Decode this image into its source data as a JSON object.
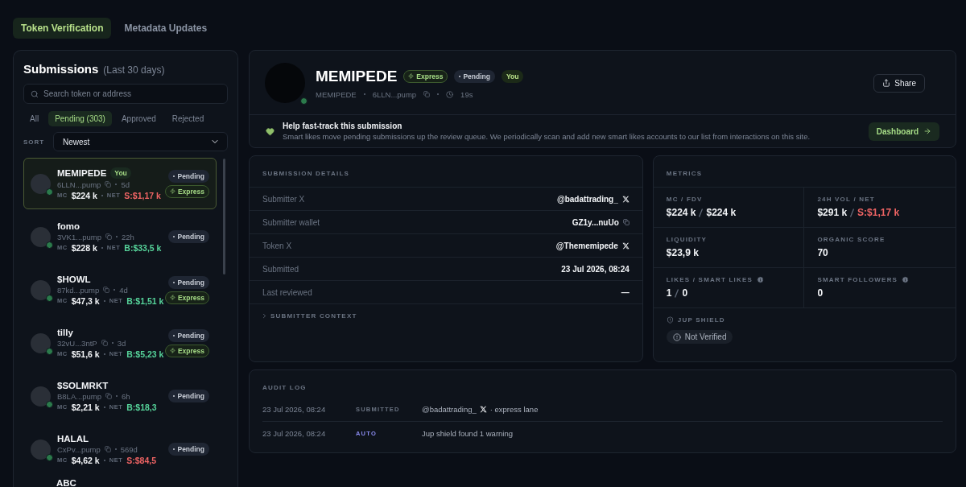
{
  "top_tabs": [
    {
      "label": "Token Verification",
      "selected": true
    },
    {
      "label": "Metadata Updates",
      "selected": false
    }
  ],
  "sidebar": {
    "title": "Submissions",
    "subtitle": "(Last 30 days)",
    "search": {
      "placeholder": "Search token or address"
    },
    "filters": [
      {
        "label": "All",
        "selected": false
      },
      {
        "label": "Pending (303)",
        "selected": true
      },
      {
        "label": "Approved",
        "selected": false
      },
      {
        "label": "Rejected",
        "selected": false
      }
    ],
    "sort_label": "SORT",
    "sort_value": "Newest",
    "items": [
      {
        "name": "MEMIPEDE",
        "badge": "You",
        "address": "6LLN...pump",
        "age": "5d",
        "mc_label": "MC",
        "mc": "$224 k",
        "net_label": "NET",
        "net": {
          "text": "S:$1,17 k",
          "kind": "sell"
        },
        "status": "Pending",
        "express": "Express",
        "selected": true
      },
      {
        "name": "fomo",
        "address": "3VK1...pump",
        "age": "22h",
        "mc_label": "MC",
        "mc": "$228 k",
        "net_label": "NET",
        "net": {
          "text": "B:$33,5 k",
          "kind": "buy"
        },
        "status": "Pending",
        "selected": false
      },
      {
        "name": "$HOWL",
        "address": "87kd...pump",
        "age": "4d",
        "mc_label": "MC",
        "mc": "$47,3 k",
        "net_label": "NET",
        "net": {
          "text": "B:$1,51 k",
          "kind": "buy"
        },
        "status": "Pending",
        "express": "Express",
        "selected": false
      },
      {
        "name": "tilly",
        "address": "32vU...3ntP",
        "age": "3d",
        "mc_label": "MC",
        "mc": "$51,6 k",
        "net_label": "NET",
        "net": {
          "text": "B:$5,23 k",
          "kind": "buy"
        },
        "status": "Pending",
        "express": "Express",
        "selected": false
      },
      {
        "name": "$SOLMRKT",
        "address": "B8LA...pump",
        "age": "6h",
        "mc_label": "MC",
        "mc": "$2,21 k",
        "net_label": "NET",
        "net": {
          "text": "B:$18,3",
          "kind": "buy"
        },
        "status": "Pending",
        "selected": false
      },
      {
        "name": "HALAL",
        "address": "CxPv...pump",
        "age": "569d",
        "mc_label": "MC",
        "mc": "$4,62 k",
        "net_label": "NET",
        "net": {
          "text": "S:$84,5",
          "kind": "sell"
        },
        "status": "Pending",
        "selected": false
      }
    ],
    "cut_item": {
      "name": "ABC"
    }
  },
  "header": {
    "name": "MEMIPEDE",
    "badges": [
      {
        "kind": "express",
        "label": "Express"
      },
      {
        "kind": "status",
        "label": "Pending"
      },
      {
        "kind": "you",
        "label": "You"
      }
    ],
    "symbol": "MEMIPEDE",
    "address": "6LLN...pump",
    "age": "19s",
    "share": "Share",
    "banner": {
      "title": "Help fast-track this submission",
      "text": "Smart likes move pending submissions up the review queue. We periodically scan and add new smart likes accounts to our list from interactions on this site.",
      "button": "Dashboard"
    }
  },
  "details": {
    "title": "SUBMISSION DETAILS",
    "rows": [
      {
        "kind": "social",
        "label": "Submitter X",
        "value": "@badattrading_"
      },
      {
        "kind": "wallet",
        "label": "Submitter wallet",
        "value": "GZ1y...nuUo"
      },
      {
        "kind": "social",
        "label": "Token X",
        "value": "@Thememipede"
      },
      {
        "kind": "plain",
        "label": "Submitted",
        "value": "23 Jul 2026, 08:24"
      },
      {
        "kind": "plain",
        "label": "Last reviewed",
        "value": "—"
      }
    ],
    "context": {
      "label": "SUBMITTER CONTEXT",
      "expanded": false
    }
  },
  "metrics": {
    "title": "METRICS",
    "cells": [
      {
        "label": "MC / FDV",
        "info": false,
        "values": [
          {
            "text": "$224 k",
            "kind": "plain"
          },
          {
            "text": "$224 k",
            "kind": "plain"
          }
        ]
      },
      {
        "label": "24H VOL / NET",
        "info": false,
        "values": [
          {
            "text": "$291 k",
            "kind": "plain"
          },
          {
            "text": "S:$1,17 k",
            "kind": "sell"
          }
        ]
      },
      {
        "label": "LIQUIDITY",
        "info": false,
        "values": [
          {
            "text": "$23,9 k",
            "kind": "plain"
          }
        ]
      },
      {
        "label": "ORGANIC SCORE",
        "info": false,
        "values": [
          {
            "text": "70",
            "kind": "plain"
          }
        ]
      },
      {
        "label": "LIKES / SMART LIKES",
        "info": true,
        "values": [
          {
            "text": "1",
            "kind": "plain"
          },
          {
            "text": "0",
            "kind": "plain"
          }
        ]
      },
      {
        "label": "SMART FOLLOWERS",
        "info": true,
        "values": [
          {
            "text": "0",
            "kind": "plain"
          }
        ]
      }
    ],
    "shield_label": "JUP SHIELD",
    "shield_status": "Not Verified"
  },
  "audit": {
    "title": "AUDIT LOG",
    "rows": [
      {
        "time": "23 Jul 2026, 08:24",
        "type": {
          "text": "SUBMITTED",
          "kind": "submitted"
        },
        "handle": "@badattrading_",
        "text": "· express lane"
      },
      {
        "time": "23 Jul 2026, 08:24",
        "type": {
          "text": "AUTO",
          "kind": "auto"
        },
        "text": "Jup shield found 1 warning"
      }
    ]
  }
}
